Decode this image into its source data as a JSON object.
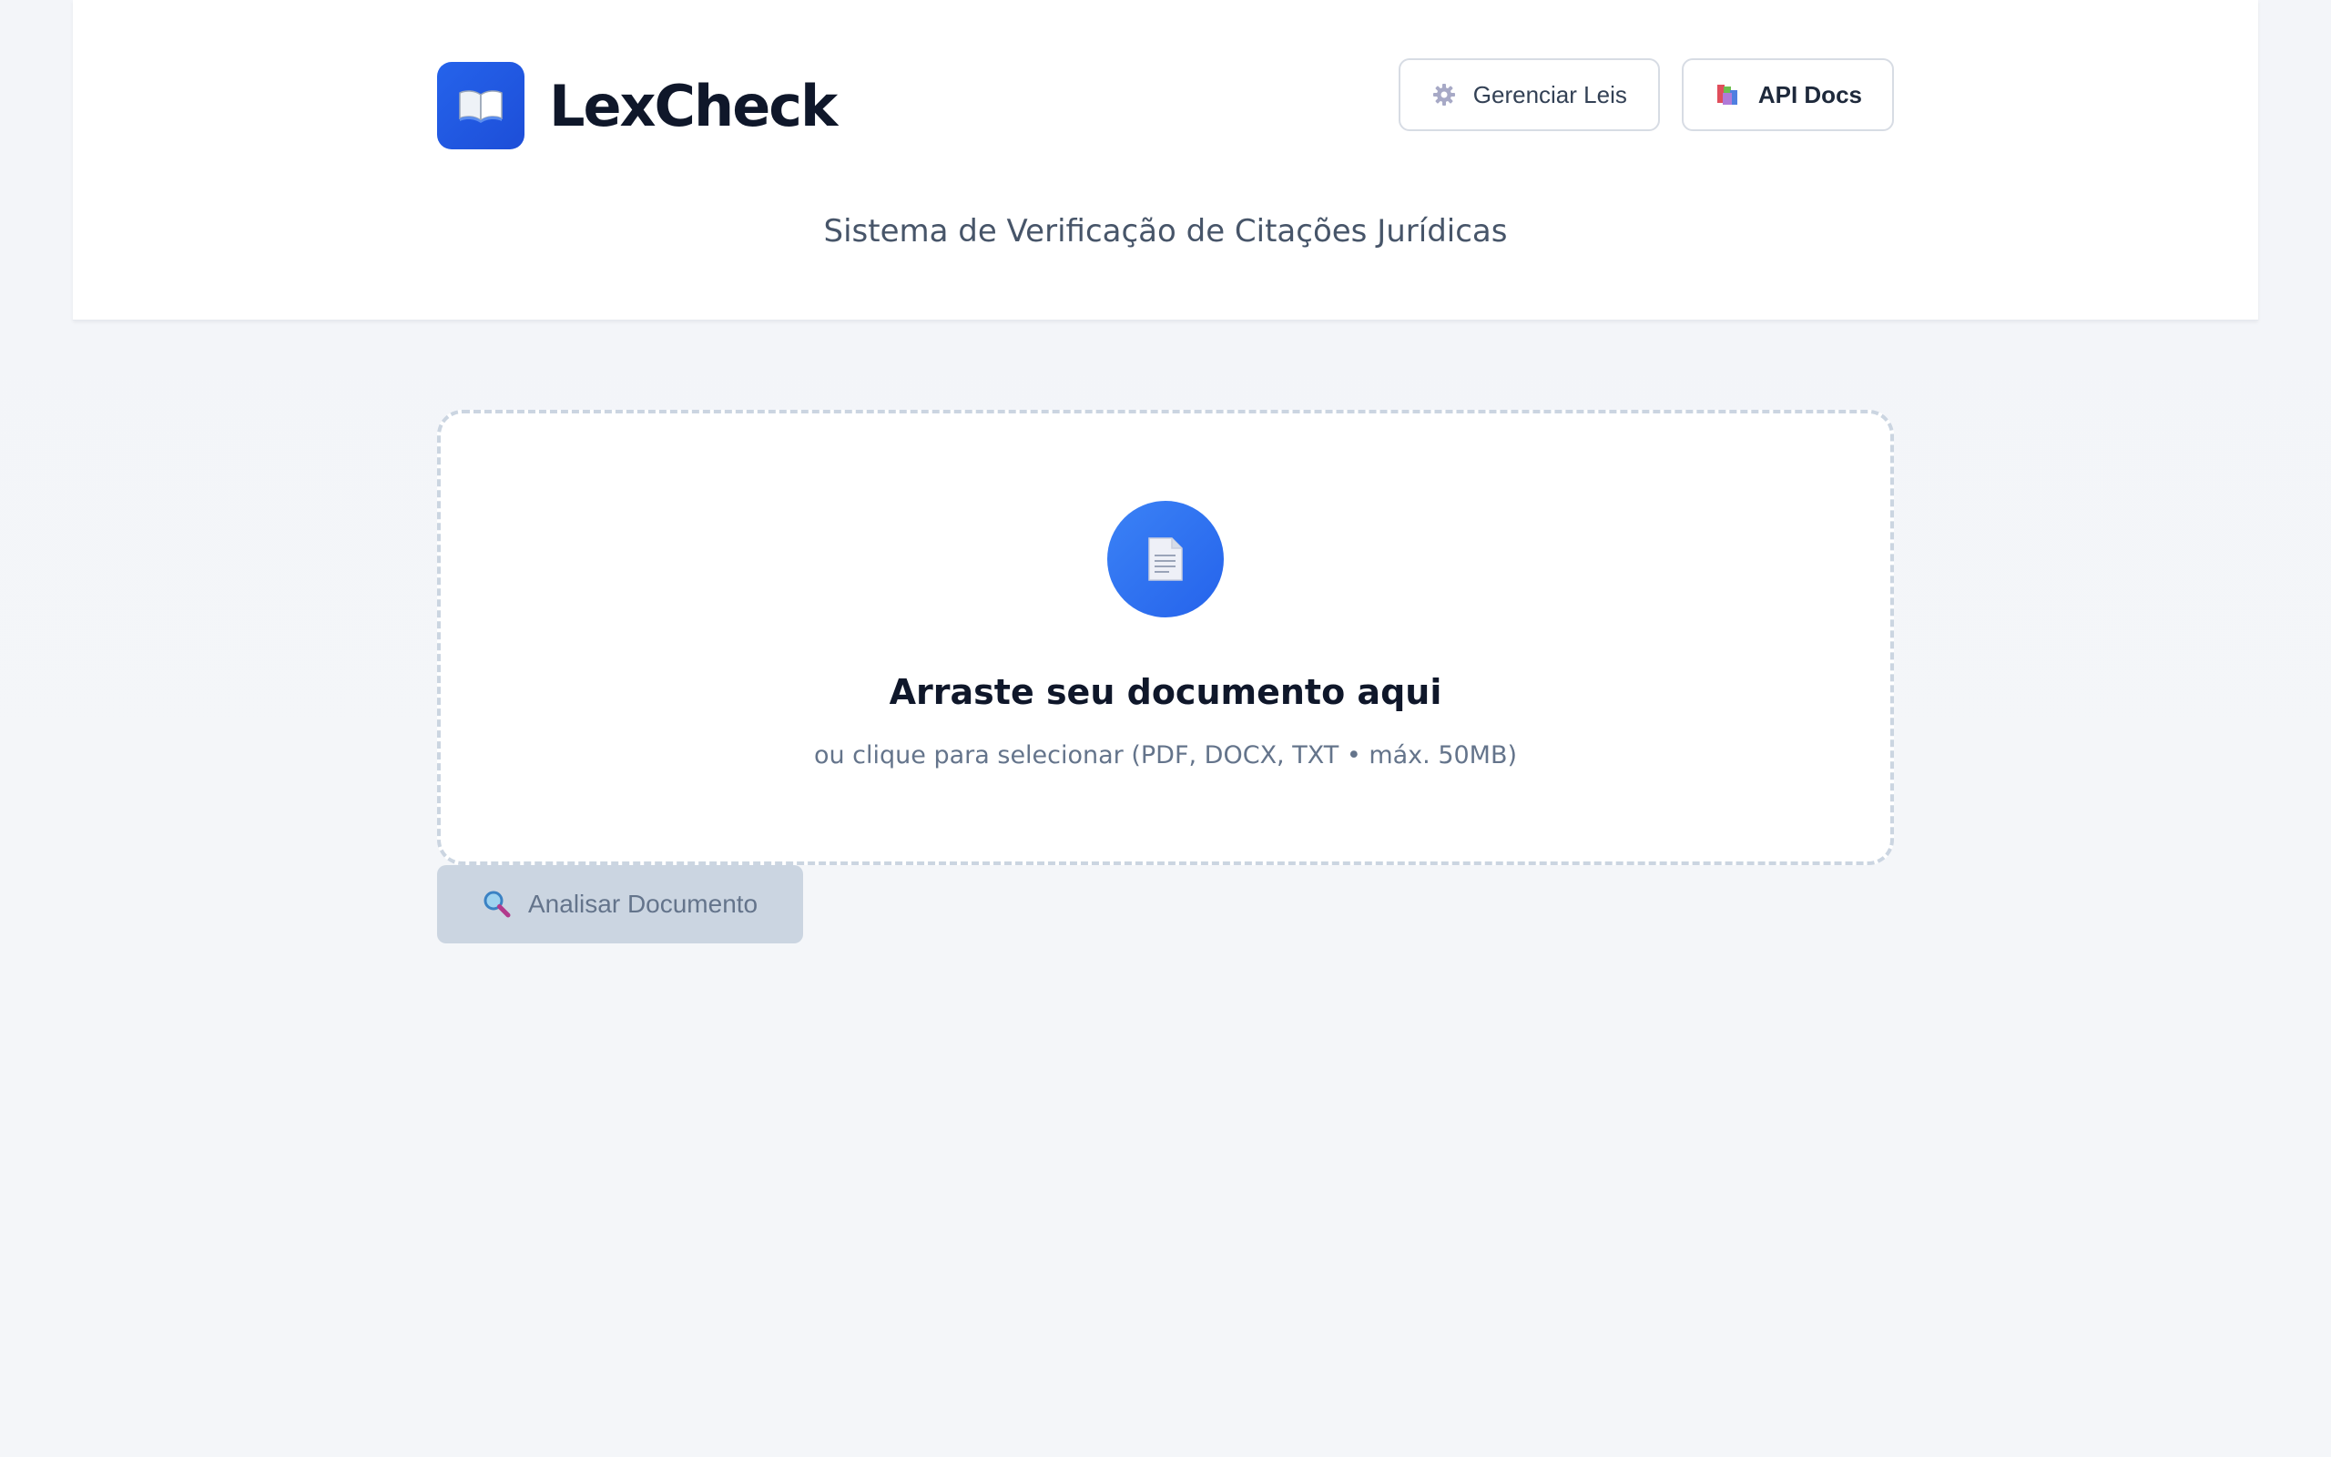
{
  "brand": {
    "name": "LexCheck",
    "logo_icon": "open-book-icon",
    "accent_color": "#2563eb"
  },
  "header": {
    "subtitle": "Sistema de Verificação de Citações Jurídicas",
    "actions": [
      {
        "label": "Gerenciar Leis",
        "icon": "gear-icon"
      },
      {
        "label": "API Docs",
        "icon": "books-icon"
      }
    ]
  },
  "upload": {
    "icon": "document-icon",
    "title": "Arraste seu documento aqui",
    "hint": "ou clique para selecionar (PDF, DOCX, TXT • máx. 50MB)"
  },
  "analyze": {
    "label": "Analisar Documento",
    "icon": "magnifier-icon",
    "enabled": false
  }
}
